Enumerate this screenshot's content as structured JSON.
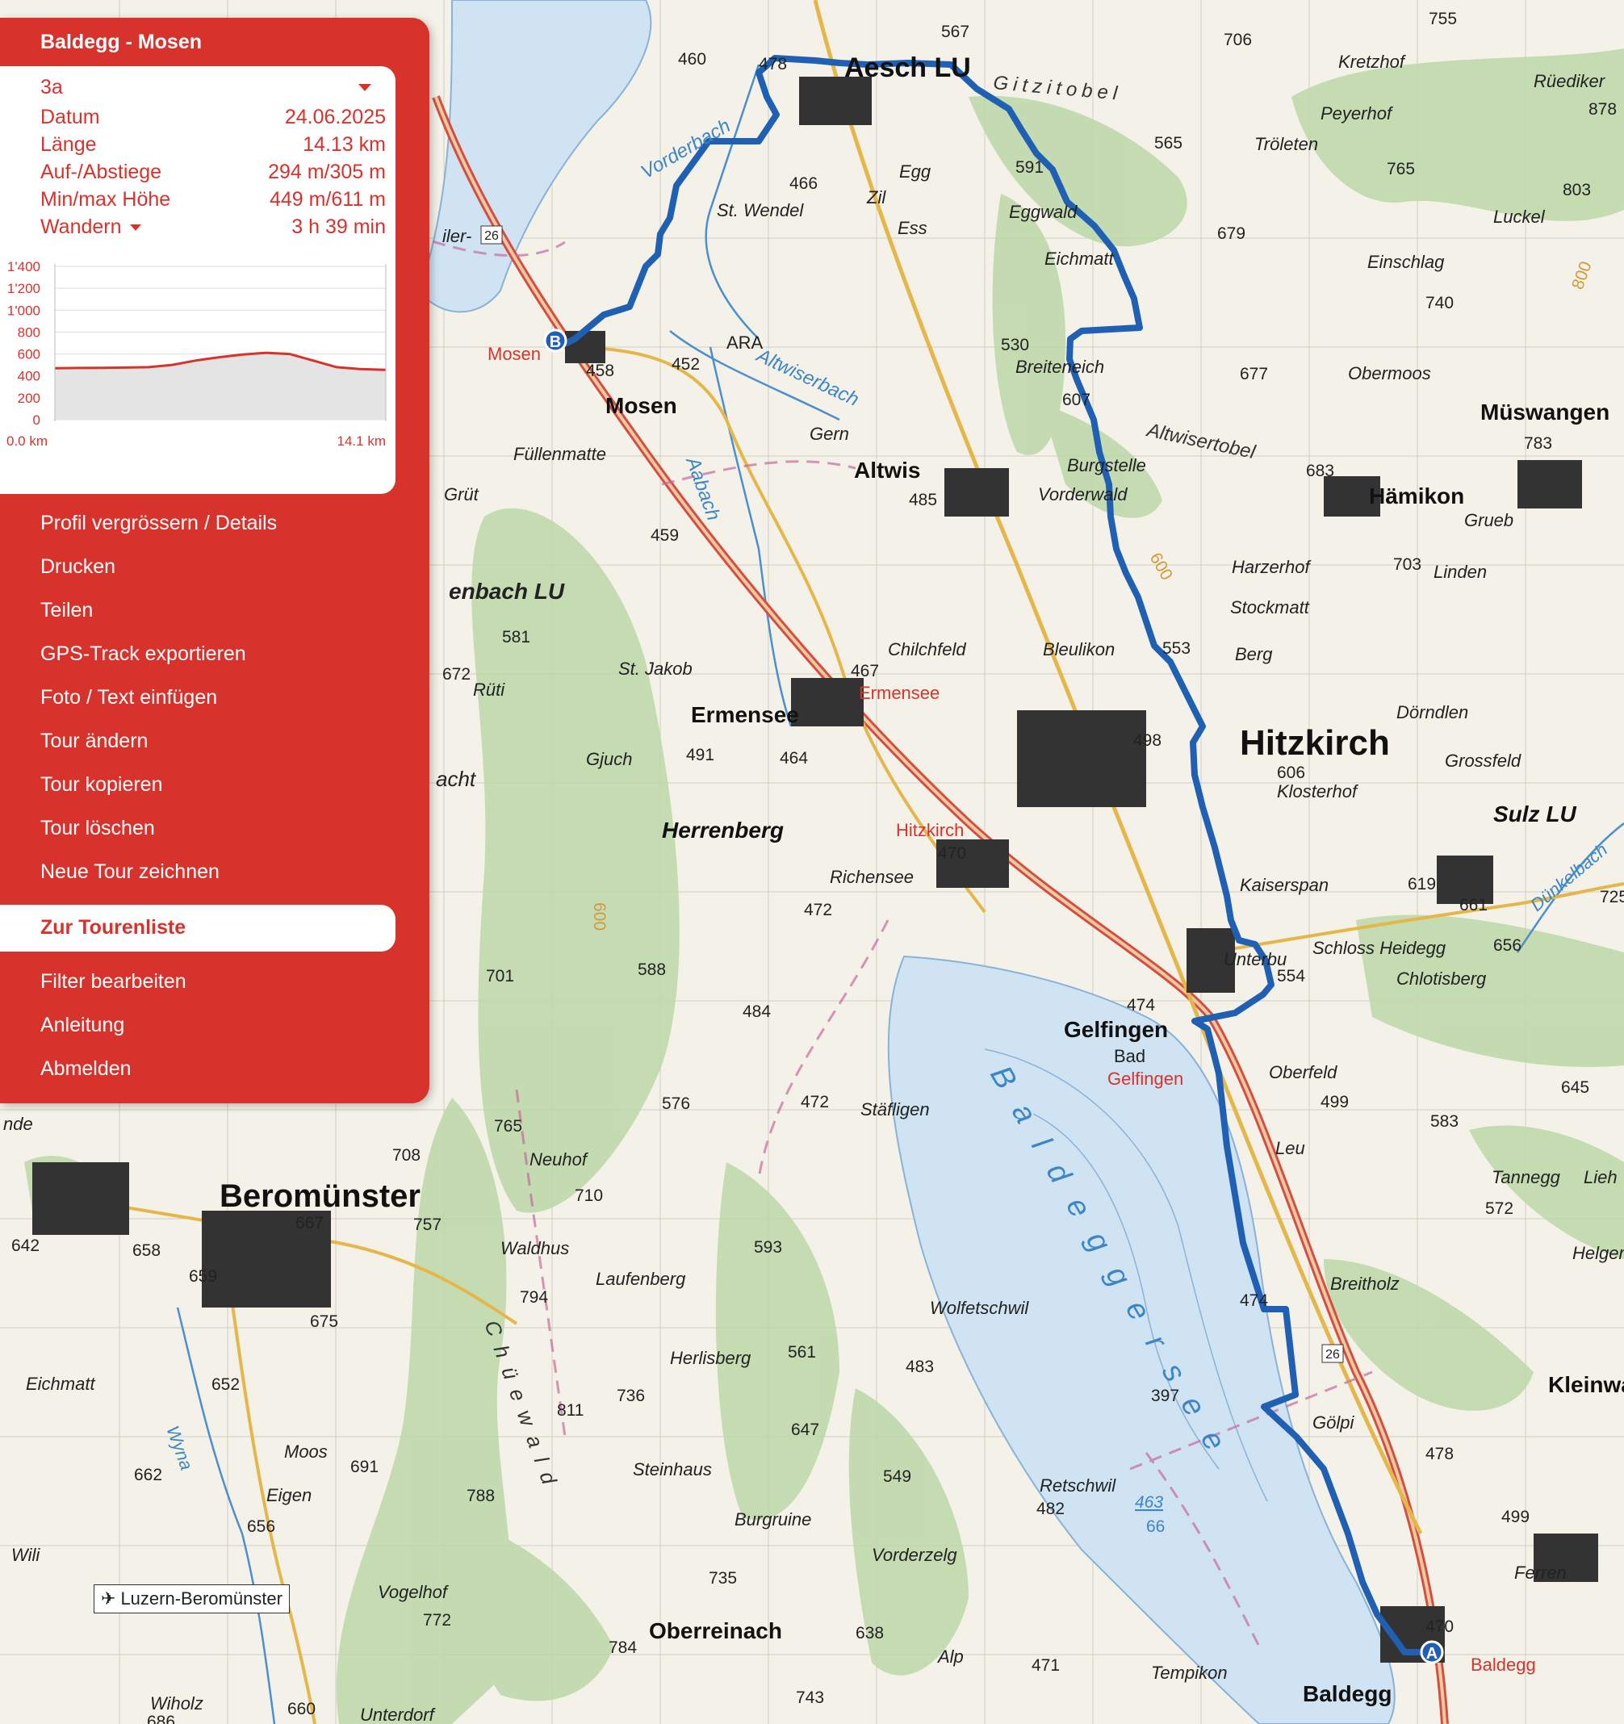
{
  "panel": {
    "title": "Baldegg - Mosen",
    "route_variant": "3a",
    "info": [
      {
        "label": "Datum",
        "value": "24.06.2025"
      },
      {
        "label": "Länge",
        "value": "14.13 km"
      },
      {
        "label": "Auf-/Abstiege",
        "value": "294 m/305 m"
      },
      {
        "label": "Min/max Höhe",
        "value": "449 m/611 m"
      },
      {
        "label": "Wandern",
        "value": "3 h 39 min"
      }
    ],
    "menu": [
      "Profil vergrössern / Details",
      "Drucken",
      "Teilen",
      "GPS-Track exportieren",
      "Foto / Text einfügen",
      "Tour ändern",
      "Tour kopieren",
      "Tour löschen",
      "Neue Tour zeichnen"
    ],
    "highlighted_item": "Zur Tourenliste",
    "menu_bottom": [
      "Filter bearbeiten",
      "Anleitung",
      "Abmelden"
    ]
  },
  "profile": {
    "y_ticks": [
      "1'400",
      "1'200",
      "1'000",
      "800",
      "600",
      "400",
      "200",
      "0"
    ],
    "x_start": "0.0 km",
    "x_end": "14.1 km"
  },
  "chart_data": {
    "type": "area",
    "xlabel": "",
    "ylabel": "",
    "ylim": [
      0,
      1400
    ],
    "xlim": [
      0,
      14.1
    ],
    "x": [
      0,
      1,
      2,
      3,
      4,
      5,
      6,
      7,
      8,
      9,
      10,
      11,
      12,
      13,
      14.1
    ],
    "values": [
      470,
      472,
      474,
      476,
      480,
      500,
      540,
      570,
      595,
      611,
      600,
      540,
      480,
      462,
      455
    ]
  },
  "map": {
    "places": [
      {
        "name": "Aesch LU",
        "kind": "major"
      },
      {
        "name": "Hitzkirch",
        "kind": "big"
      },
      {
        "name": "Beromünster",
        "kind": "major"
      },
      {
        "name": "Mosen",
        "kind": "town"
      },
      {
        "name": "Altwis",
        "kind": "town"
      },
      {
        "name": "Ermensee",
        "kind": "town"
      },
      {
        "name": "Herrenberg",
        "kind": "town"
      },
      {
        "name": "Gelfingen",
        "kind": "town"
      },
      {
        "name": "Baldegg",
        "kind": "town"
      },
      {
        "name": "Hämikon",
        "kind": "town"
      },
      {
        "name": "Müswangen",
        "kind": "town"
      },
      {
        "name": "Sulz LU",
        "kind": "town"
      },
      {
        "name": "Oberreinach",
        "kind": "town"
      },
      {
        "name": "Kleinwa",
        "kind": "town"
      },
      {
        "name": "St. Wendel",
        "kind": "small"
      },
      {
        "name": "Egg",
        "kind": "small"
      },
      {
        "name": "Zil",
        "kind": "small"
      },
      {
        "name": "Ess",
        "kind": "small"
      },
      {
        "name": "Eggwald",
        "kind": "small"
      },
      {
        "name": "Eichmatt",
        "kind": "small"
      },
      {
        "name": "Breiteneich",
        "kind": "small"
      },
      {
        "name": "Burgstelle",
        "kind": "small"
      },
      {
        "name": "Vorderwald",
        "kind": "small"
      },
      {
        "name": "Gern",
        "kind": "small"
      },
      {
        "name": "Füllenmatte",
        "kind": "small"
      },
      {
        "name": "Grüt",
        "kind": "small"
      },
      {
        "name": "St. Jakob",
        "kind": "small"
      },
      {
        "name": "Rüti",
        "kind": "small"
      },
      {
        "name": "Gjuch",
        "kind": "small"
      },
      {
        "name": "Chilchfeld",
        "kind": "small"
      },
      {
        "name": "Bleulikon",
        "kind": "small"
      },
      {
        "name": "Berg",
        "kind": "small"
      },
      {
        "name": "Stockmatt",
        "kind": "small"
      },
      {
        "name": "Harzerhof",
        "kind": "small"
      },
      {
        "name": "Linden",
        "kind": "small"
      },
      {
        "name": "Grueb",
        "kind": "small"
      },
      {
        "name": "Dörndlen",
        "kind": "small"
      },
      {
        "name": "Grossfeld",
        "kind": "small"
      },
      {
        "name": "Klosterhof",
        "kind": "small"
      },
      {
        "name": "Kaiserspan",
        "kind": "small"
      },
      {
        "name": "Schloss Heidegg",
        "kind": "small"
      },
      {
        "name": "Chlotisberg",
        "kind": "small"
      },
      {
        "name": "Unterbu",
        "kind": "small"
      },
      {
        "name": "Richensee",
        "kind": "small"
      },
      {
        "name": "Stäfligen",
        "kind": "small"
      },
      {
        "name": "Oberfeld",
        "kind": "small"
      },
      {
        "name": "Leu",
        "kind": "small"
      },
      {
        "name": "Gölpi",
        "kind": "small"
      },
      {
        "name": "Tannegg",
        "kind": "small"
      },
      {
        "name": "Breitholz",
        "kind": "small"
      },
      {
        "name": "Wolfetschwil",
        "kind": "small"
      },
      {
        "name": "Retschwil",
        "kind": "small"
      },
      {
        "name": "Tempikon",
        "kind": "small"
      },
      {
        "name": "Ferren",
        "kind": "small"
      },
      {
        "name": "Neuhof",
        "kind": "small"
      },
      {
        "name": "Waldhus",
        "kind": "small"
      },
      {
        "name": "Laufenberg",
        "kind": "small"
      },
      {
        "name": "Herlisberg",
        "kind": "small"
      },
      {
        "name": "Steinhaus",
        "kind": "small"
      },
      {
        "name": "Burgruine",
        "kind": "small"
      },
      {
        "name": "Vorderzelg",
        "kind": "small"
      },
      {
        "name": "Alp",
        "kind": "small"
      },
      {
        "name": "Eichmatt",
        "kind": "small"
      },
      {
        "name": "Moos",
        "kind": "small"
      },
      {
        "name": "Eigen",
        "kind": "small"
      },
      {
        "name": "Wili",
        "kind": "small"
      },
      {
        "name": "Vogelhof",
        "kind": "small"
      },
      {
        "name": "Wiholz",
        "kind": "small"
      },
      {
        "name": "Unterdorf",
        "kind": "small"
      },
      {
        "name": "Tröleten",
        "kind": "small"
      },
      {
        "name": "Peyerhof",
        "kind": "small"
      },
      {
        "name": "Kretzhof",
        "kind": "small"
      },
      {
        "name": "Luckel",
        "kind": "small"
      },
      {
        "name": "Einschlag",
        "kind": "small"
      },
      {
        "name": "Obermoos",
        "kind": "small"
      },
      {
        "name": "Rüediker",
        "kind": "small"
      },
      {
        "name": "Helger",
        "kind": "small"
      },
      {
        "name": "Lieh",
        "kind": "small"
      },
      {
        "name": "ARA",
        "kind": "small"
      },
      {
        "name": "Bad",
        "kind": "small"
      },
      {
        "name": "enbach LU",
        "kind": "town"
      },
      {
        "name": "acht",
        "kind": "small"
      },
      {
        "name": "nde",
        "kind": "small"
      },
      {
        "name": "iler-",
        "kind": "small"
      }
    ],
    "water_labels": [
      "Vorderbach",
      "Altwiserbach",
      "Aabach",
      "Wyna",
      "Dünkelbach",
      "Gitzitobel",
      "Altwisertobel",
      "Chüewald",
      "Baldeggersee"
    ],
    "stations": [
      "Mosen",
      "Ermensee",
      "Hitzkirch",
      "Gelfingen",
      "Baldegg"
    ],
    "heights": [
      "460",
      "478",
      "466",
      "567",
      "591",
      "565",
      "706",
      "755",
      "765",
      "878",
      "803",
      "740",
      "679",
      "530",
      "607",
      "677",
      "683",
      "783",
      "703",
      "485",
      "459",
      "458",
      "452",
      "581",
      "467",
      "464",
      "491",
      "672",
      "553",
      "498",
      "606",
      "470",
      "472",
      "619",
      "661",
      "656",
      "725",
      "554",
      "474",
      "701",
      "588",
      "484",
      "576",
      "472",
      "765",
      "708",
      "667",
      "757",
      "642",
      "658",
      "659",
      "675",
      "710",
      "794",
      "593",
      "561",
      "483",
      "736",
      "811",
      "647",
      "549",
      "397",
      "463",
      "66",
      "482",
      "471",
      "474",
      "478",
      "499",
      "470",
      "572",
      "645",
      "583",
      "499",
      "652",
      "662",
      "691",
      "788",
      "656",
      "735",
      "784",
      "638",
      "743",
      "660",
      "686",
      "772",
      "800",
      "600",
      "600"
    ],
    "road_number": "26",
    "marker_start": "A",
    "marker_end": "B",
    "airfield": "Luzern-Beromünster",
    "scale": "1000 m"
  },
  "colors": {
    "panel_red": "#d7322c",
    "route_blue": "#1f5fb4",
    "lake": "#cfe3f3",
    "forest": "#bcd7a8"
  }
}
